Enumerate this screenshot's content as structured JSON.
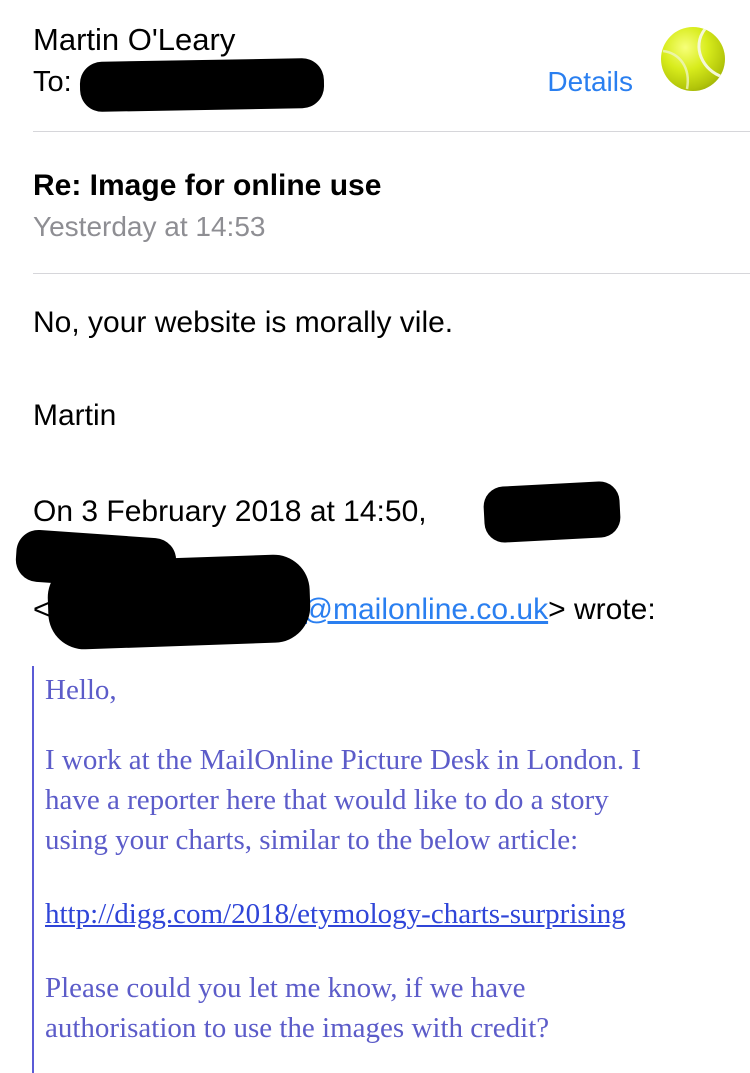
{
  "header": {
    "sender_name": "Martin O'Leary",
    "to_label": "To:",
    "details_label": "Details",
    "avatar_icon": "tennis-ball-icon"
  },
  "message": {
    "subject": "Re: Image for online use",
    "timestamp": "Yesterday at 14:53",
    "body_lines": [
      "No, your website is morally vile.",
      "Martin"
    ],
    "attribution_start": "On 3 February 2018 at 14:50,",
    "attribution_open_bracket": "<",
    "attribution_email_suffix": "@mailonline.co.uk",
    "attribution_end": "> wrote:"
  },
  "quoted": {
    "greeting": "Hello,",
    "para1_lines": [
      "I work at the MailOnline Picture Desk in London. I",
      "have a reporter here that would like to do a story",
      "using your charts, similar to the below article:"
    ],
    "link": "http://digg.com/2018/etymology-charts-surprising",
    "para2_lines": [
      "Please could you let me know, if we have",
      "authorisation to use the images with credit?"
    ]
  },
  "colors": {
    "link_blue": "#2a7ff0",
    "quote_text": "#5c5cc9",
    "quote_bar": "#5b5bd6",
    "timestamp_gray": "#8e8e93"
  }
}
